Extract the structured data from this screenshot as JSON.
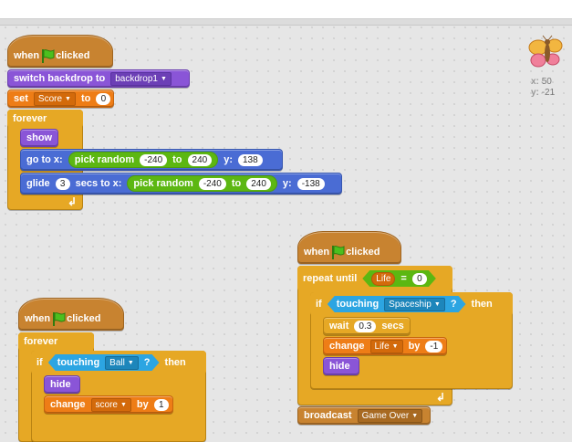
{
  "editor": {
    "script1": {
      "hat": {
        "when": "when",
        "clicked": "clicked"
      },
      "switch_backdrop": {
        "label": "switch backdrop to",
        "value": "backdrop1"
      },
      "set": {
        "label": "set",
        "var": "Score",
        "to": "to",
        "value": "0"
      },
      "forever": "forever",
      "show": "show",
      "goto": {
        "label": "go to x:",
        "random": "pick random",
        "from": "-240",
        "to_label": "to",
        "to": "240",
        "y_label": "y:",
        "y": "138"
      },
      "glide": {
        "label": "glide",
        "secs": "3",
        "secs_label": "secs to x:",
        "random": "pick random",
        "from": "-240",
        "to_label": "to",
        "to": "240",
        "y_label": "y:",
        "y": "-138"
      }
    },
    "script2": {
      "hat": {
        "when": "when",
        "clicked": "clicked"
      },
      "forever": "forever",
      "if": "if",
      "touching": {
        "label": "touching",
        "target": "Ball",
        "q": "?"
      },
      "then": "then",
      "hide": "hide",
      "change": {
        "label": "change",
        "var": "score",
        "by": "by",
        "value": "1"
      }
    },
    "script3": {
      "hat": {
        "when": "when",
        "clicked": "clicked"
      },
      "repeat_until": "repeat until",
      "life_eq": {
        "var": "Life",
        "op": "=",
        "value": "0"
      },
      "if": "if",
      "touching": {
        "label": "touching",
        "target": "Spaceship",
        "q": "?"
      },
      "then": "then",
      "wait": {
        "label": "wait",
        "value": "0.3",
        "unit": "secs"
      },
      "change": {
        "label": "change",
        "var": "Life",
        "by": "by",
        "value": "-1"
      },
      "hide": "hide",
      "broadcast": {
        "label": "broadcast",
        "message": "Game Over"
      }
    }
  },
  "sprite_info": {
    "x_label": "x:",
    "x": "50",
    "y_label": "y:",
    "y": "-21"
  },
  "colors": {
    "control": "#e6a825",
    "looks": "#8a55d7",
    "data": "#ee7d16",
    "motion": "#4a6cd4",
    "sensing": "#2ca5e2",
    "events": "#c88330",
    "operators": "#5cb712"
  }
}
